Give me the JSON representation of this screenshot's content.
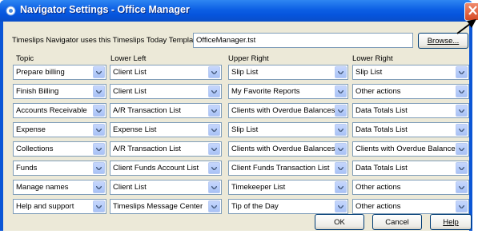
{
  "window": {
    "title": "Navigator Settings - Office Manager"
  },
  "template": {
    "label": "Timeslips Navigator uses this Timeslips Today Template:",
    "value": "OfficeManager.tst",
    "browse_label": "Browse..."
  },
  "columns": {
    "topic": "Topic",
    "lower_left": "Lower Left",
    "upper_right": "Upper Right",
    "lower_right": "Lower Right"
  },
  "rows": [
    {
      "topic": "Prepare billing",
      "lower_left": "Client List",
      "upper_right": "Slip List",
      "lower_right": "Slip List"
    },
    {
      "topic": "Finish Billing",
      "lower_left": "Client List",
      "upper_right": "My Favorite Reports",
      "lower_right": "Other actions"
    },
    {
      "topic": "Accounts Receivable",
      "lower_left": "A/R Transaction List",
      "upper_right": "Clients with Overdue Balances",
      "lower_right": "Data Totals List"
    },
    {
      "topic": "Expense",
      "lower_left": "Expense List",
      "upper_right": "Slip List",
      "lower_right": "Data Totals List"
    },
    {
      "topic": "Collections",
      "lower_left": "A/R Transaction List",
      "upper_right": "Clients with Overdue Balances",
      "lower_right": "Clients with Overdue Balances"
    },
    {
      "topic": "Funds",
      "lower_left": "Client Funds Account List",
      "upper_right": "Client Funds Transaction List",
      "lower_right": "Data Totals List"
    },
    {
      "topic": "Manage names",
      "lower_left": "Client List",
      "upper_right": "Timekeeper List",
      "lower_right": "Other actions"
    },
    {
      "topic": "Help and support",
      "lower_left": "Timeslips Message Center",
      "upper_right": "Tip of the Day",
      "lower_right": "Other actions"
    }
  ],
  "buttons": {
    "ok": "OK",
    "cancel": "Cancel",
    "help": "Help"
  },
  "colors": {
    "titlebar": "#0654dc",
    "dialog_bg": "#ece9d8",
    "field_border": "#7f9db9"
  }
}
